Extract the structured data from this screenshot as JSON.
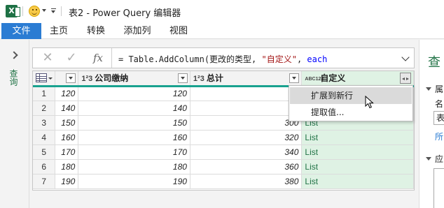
{
  "window": {
    "title": "表2 - Power Query 编辑器",
    "app_icon": "excel-icon",
    "quick_access": [
      "smiley-icon",
      "customize-icon"
    ]
  },
  "ribbon": {
    "tabs": [
      "文件",
      "主页",
      "转换",
      "添加列",
      "视图"
    ],
    "active_tab": "文件",
    "accent_color": "#2b7cd3"
  },
  "left_panel": {
    "label": "查询"
  },
  "formula_bar": {
    "cancel_glyph": "✕",
    "confirm_glyph": "✓",
    "fx_glyph": "fx",
    "prefix": "= Table.AddColumn(更改的类型, ",
    "string_part": "\"自定义\"",
    "comma": ", ",
    "keyword": "each"
  },
  "grid": {
    "columns": [
      {
        "type": "1²3",
        "name": "公司缴纳"
      },
      {
        "type": "1²3",
        "name": "总计"
      },
      {
        "type": "ABC123",
        "name": "自定义"
      }
    ],
    "rows": [
      {
        "n": "1",
        "a": "120",
        "b": "120",
        "c": "",
        "d": ""
      },
      {
        "n": "2",
        "a": "140",
        "b": "140",
        "c": "",
        "d": ""
      },
      {
        "n": "3",
        "a": "150",
        "b": "150",
        "c": "300",
        "d": "List"
      },
      {
        "n": "4",
        "a": "160",
        "b": "160",
        "c": "320",
        "d": "List"
      },
      {
        "n": "5",
        "a": "170",
        "b": "170",
        "c": "340",
        "d": "List"
      },
      {
        "n": "6",
        "a": "180",
        "b": "180",
        "c": "360",
        "d": "List"
      },
      {
        "n": "7",
        "a": "190",
        "b": "190",
        "c": "380",
        "d": "List"
      }
    ],
    "header_accent": "#19a28f",
    "custom_col_bg": "#dff2e4",
    "list_color": "#217346"
  },
  "context_menu": {
    "items": [
      "扩展到新行",
      "提取值..."
    ],
    "highlighted_index": 0
  },
  "right_pane": {
    "title": "查",
    "section1": "属",
    "name_label": "名",
    "name_value": "表",
    "all_link": "所",
    "section2": "应"
  }
}
